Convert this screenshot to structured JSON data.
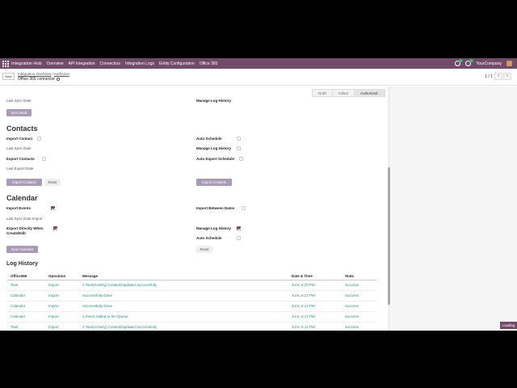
{
  "nav": {
    "brand": "Integration Hub",
    "menu": [
      "Overview",
      "API Integration",
      "Connectors",
      "Integration Logs",
      "Entity Configuration",
      "Office 365"
    ],
    "company": "YourCompany",
    "chat_badge": "1",
    "activity_badge": "1"
  },
  "control": {
    "new_label": "New",
    "breadcrumb": [
      "Integration Overview",
      "Authorize"
    ],
    "breadcrumb_sep": "/",
    "title": "Office 365 connector",
    "pager": "1 / 1",
    "prev": "‹",
    "next": "›"
  },
  "status": [
    "Draft",
    "Failed",
    "Authorized"
  ],
  "status_active": "Authorized",
  "top": {
    "last_sync_date": "Last Sync Date",
    "manage_log_history": "Manage Log History",
    "sync_btn": "Sync Mails"
  },
  "contacts": {
    "title": "Contacts",
    "import_contact": "Import Contact",
    "last_sync_date": "Last Sync Date",
    "export_contacts": "Export Contacts",
    "last_export_date": "Last Export Date",
    "auto_schedule": "Auto Schedule",
    "manage_log_history": "Manage Log History",
    "auto_export_schedule": "Auto Export Schedule",
    "import_btn": "Import Contacts",
    "reset_btn": "Reset",
    "export_btn": "Export Contacts"
  },
  "calendar": {
    "title": "Calendar",
    "import_events": "Import Events",
    "last_sync_date_import": "Last Sync Date Import",
    "export_directly_l1": "Export Directly When",
    "export_directly_l2": "Create/Edit",
    "import_between_dates": "Import Between Dates",
    "manage_log_history": "Manage Log History",
    "auto_schedule": "Auto Schedule",
    "sync_btn": "Sync Calendar",
    "reset_btn": "Reset"
  },
  "log": {
    "title": "Log History",
    "columns": [
      "Office365",
      "Operation",
      "Message",
      "Date & Time",
      "State"
    ],
    "rows": [
      [
        "Task",
        "Import",
        "2 Task(Activity) Created/Updated Successfully",
        "Jul 6, 6:33 PM",
        "Success"
      ],
      [
        "Calender",
        "Import",
        "Successfully Done",
        "Jul 6, 6:17 PM",
        "Success"
      ],
      [
        "Calender",
        "Import",
        "Successfully Done",
        "Jul 6, 6:17 PM",
        "Success"
      ],
      [
        "Calender",
        "Import",
        "1 Event Added to the Queue",
        "Jul 6, 6:17 PM",
        "Success"
      ],
      [
        "Task",
        "Import",
        "2 Task(Activity) Created/Updated Successfully",
        "Jul 6, 6:14 PM",
        "Success"
      ]
    ]
  },
  "loading": "Loading",
  "colors": {
    "brand": "#714b67",
    "link": "#2c8d7f",
    "button": "#a99bb4"
  }
}
